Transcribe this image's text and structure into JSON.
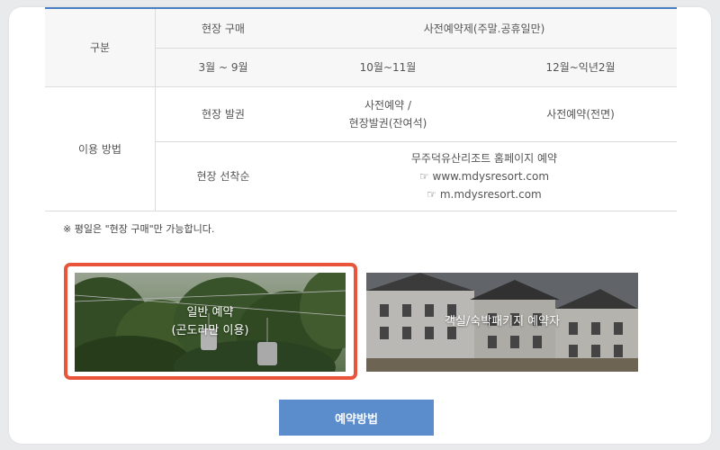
{
  "table": {
    "header": {
      "category": "구분",
      "onsite_purchase": "현장 구매",
      "advance_reservation": "사전예약제(주말.공휴일만)",
      "period_1": "3월 ~ 9월",
      "period_2": "10월~11월",
      "period_3": "12월~익년2월"
    },
    "usage_label": "이용 방법",
    "row1": {
      "col1": "현장 발권",
      "col2_line1": "사전예약 /",
      "col2_line2": "현장발권(잔여석)",
      "col3": "사전예약(전면)"
    },
    "row2": {
      "col1": "현장 선착순",
      "col2_line1": "무주덕유산리조트 홈페이지 예약",
      "col2_line2": "☞ www.mdysresort.com",
      "col2_line3": "☞ m.mdysresort.com"
    }
  },
  "note": "※ 평일은 \"현장 구매\"만 가능합니다.",
  "banners": {
    "general": {
      "line1": "일반 예약",
      "line2": "(곤도라만 이용)"
    },
    "package": {
      "label": "객실/숙박패키지 예약자"
    }
  },
  "button": {
    "label": "예약방법"
  },
  "colors": {
    "accent": "#4a7fc1",
    "highlight": "#e8553b",
    "button": "#5b8ccc"
  }
}
